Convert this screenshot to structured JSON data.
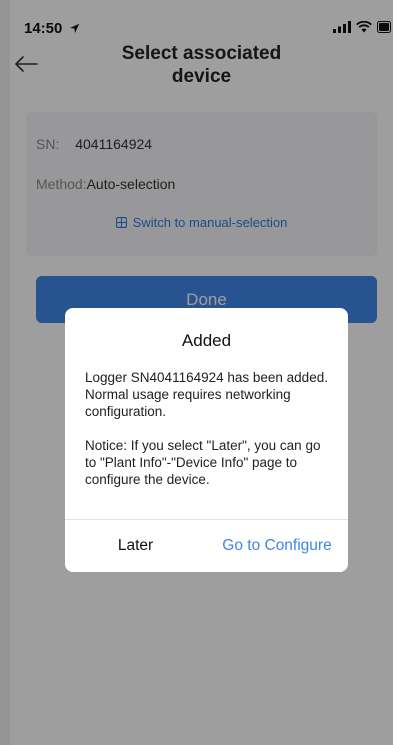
{
  "status_bar": {
    "time": "14:50",
    "icons": [
      "location-arrow-icon",
      "signal-icon",
      "wifi-icon",
      "battery-icon"
    ]
  },
  "header": {
    "title_line1": "Select associated",
    "title_line2": "device",
    "back_icon": "back-arrow-icon"
  },
  "card": {
    "sn_label": "SN:",
    "sn_value": "4041164924",
    "method_label": "Method:",
    "method_value": "Auto-selection",
    "switch_link": "Switch to manual-selection",
    "switch_icon": "switch-icon"
  },
  "done_button": "Done",
  "dialog": {
    "title": "Added",
    "message_1": "Logger SN4041164924 has been added. Normal usage requires networking configuration.",
    "message_2": "Notice: If you select \"Later\", you can go to \"Plant Info\"-\"Device Info\" page to configure the device.",
    "later_button": "Later",
    "configure_button": "Go to Configure"
  },
  "colors": {
    "accent": "#3f86e8",
    "link": "#2b7be0",
    "overlay": "rgba(0,0,0,0.38)"
  }
}
